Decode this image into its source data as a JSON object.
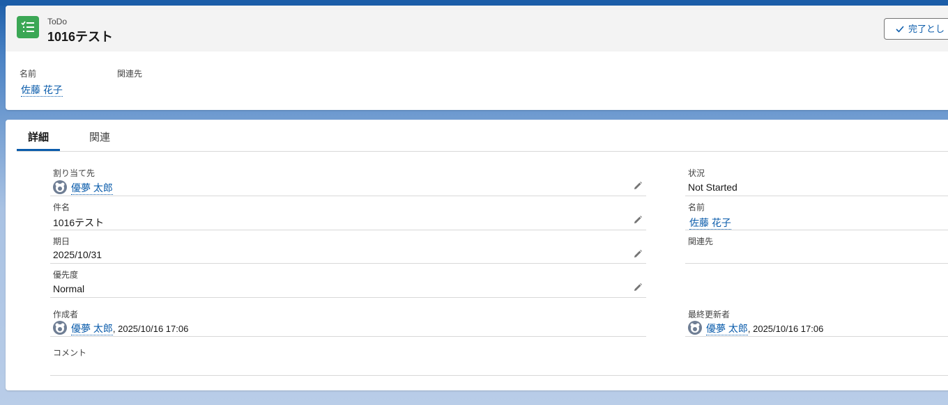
{
  "header": {
    "object_label": "ToDo",
    "record_title": "1016テスト",
    "complete_button": "完了とし",
    "highlights": [
      {
        "label": "名前",
        "value": "佐藤 花子"
      },
      {
        "label": "関連先",
        "value": ""
      }
    ]
  },
  "tabs": [
    {
      "label": "詳細",
      "active": true
    },
    {
      "label": "関連",
      "active": false
    }
  ],
  "details": {
    "assigned_to": {
      "label": "割り当て先",
      "value": "優夢 太郎"
    },
    "subject": {
      "label": "件名",
      "value": "1016テスト"
    },
    "due_date": {
      "label": "期日",
      "value": "2025/10/31"
    },
    "priority": {
      "label": "優先度",
      "value": "Normal"
    },
    "created_by": {
      "label": "作成者",
      "user": "優夢 太郎",
      "datetime": ", 2025/10/16 17:06"
    },
    "comment": {
      "label": "コメント",
      "value": ""
    },
    "status": {
      "label": "状況",
      "value": "Not Started"
    },
    "name": {
      "label": "名前",
      "value": "佐藤 花子"
    },
    "related_to": {
      "label": "関連先",
      "value": ""
    },
    "last_modified_by": {
      "label": "最終更新者",
      "user": "優夢 太郎",
      "datetime": ", 2025/10/16 17:06"
    }
  },
  "colors": {
    "brand_blue": "#0b5cab",
    "todo_icon_green": "#3ba755",
    "page_background": "#b9cde8"
  },
  "icons": [
    "todo-list-icon",
    "check-icon",
    "edit-pencil-icon",
    "user-avatar-icon"
  ]
}
